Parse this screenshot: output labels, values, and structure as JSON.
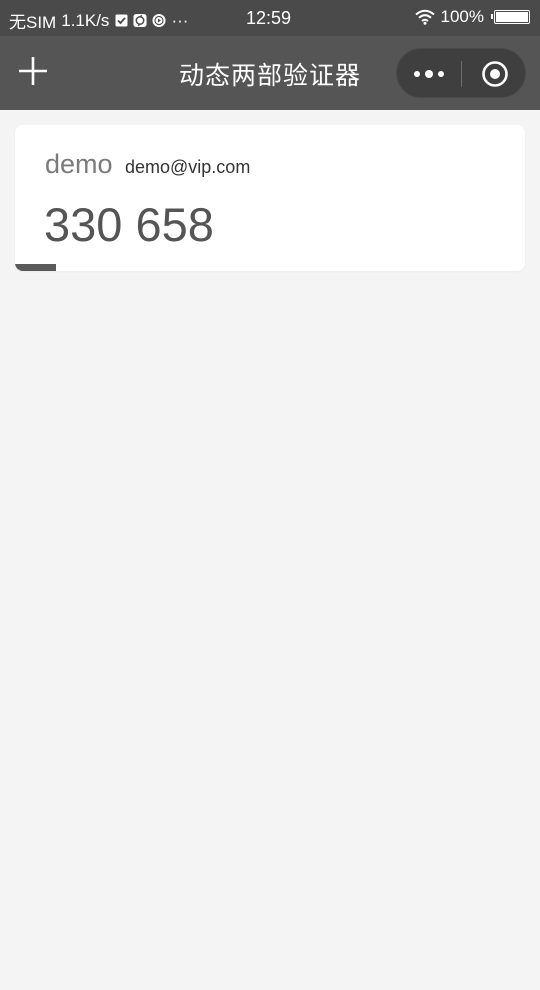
{
  "status_bar": {
    "carrier": "无SIM",
    "speed": "1.1K/s",
    "notification_icons": [
      "check-box-icon",
      "sync-icon",
      "play-circle-icon"
    ],
    "more": "···",
    "time": "12:59",
    "battery_label": "100%",
    "battery_level": 1.0
  },
  "nav": {
    "title": "动态两部验证器",
    "add_icon": "plus-icon",
    "more_icon": "more-dots-icon",
    "close_icon": "target-circle-icon"
  },
  "accounts": [
    {
      "issuer": "demo",
      "account": "demo@vip.com",
      "code": "330 658",
      "time_remaining_fraction": 0.08
    }
  ],
  "colors": {
    "nav_background": "#555555",
    "status_background": "#4a4a4a",
    "page_background": "#f4f4f4",
    "card_background": "#ffffff",
    "code_text": "#555555",
    "progress": "#5a5a5a"
  }
}
